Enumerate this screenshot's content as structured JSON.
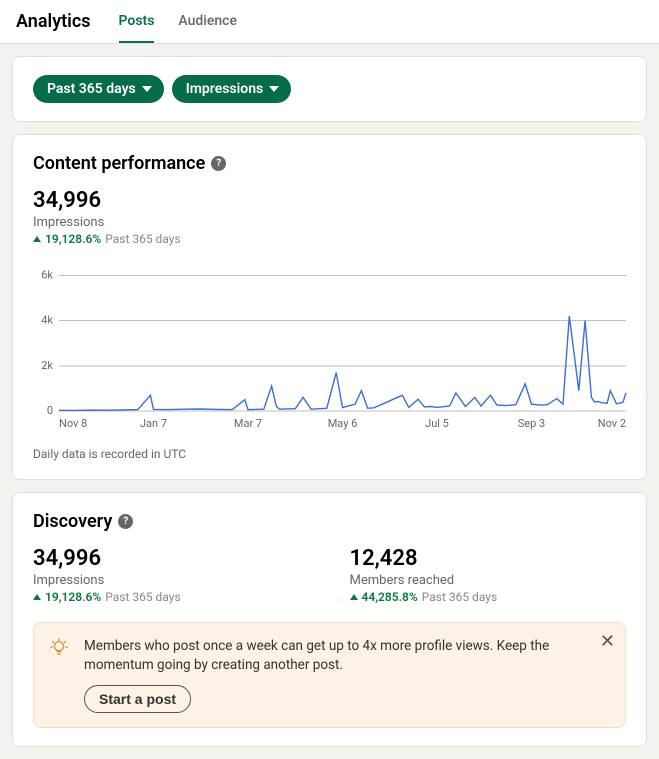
{
  "header": {
    "title": "Analytics",
    "tabs": {
      "posts": "Posts",
      "audience": "Audience"
    }
  },
  "filters": {
    "range": "Past 365 days",
    "metric": "Impressions"
  },
  "content_performance": {
    "heading": "Content performance",
    "metric_value": "34,996",
    "metric_label": "Impressions",
    "delta": "19,128.6%",
    "delta_period": "Past 365 days",
    "chart_note": "Daily data is recorded in UTC"
  },
  "discovery": {
    "heading": "Discovery",
    "impressions": {
      "value": "34,996",
      "label": "Impressions",
      "delta": "19,128.6%",
      "delta_period": "Past 365 days"
    },
    "members_reached": {
      "value": "12,428",
      "label": "Members reached",
      "delta": "44,285.8%",
      "delta_period": "Past 365 days"
    },
    "tip": {
      "text": "Members who post once a week can get up to 4x more profile views. Keep the momentum going by creating another post.",
      "cta": "Start a post"
    }
  },
  "chart_data": {
    "type": "line",
    "title": "",
    "xlabel": "",
    "ylabel": "",
    "ylim": [
      0,
      6500
    ],
    "y_ticks": [
      0,
      2000,
      4000,
      6000
    ],
    "y_tick_labels": [
      "0",
      "2k",
      "4k",
      "6k"
    ],
    "x_tick_labels": [
      "Nov 8",
      "Jan 7",
      "Mar 7",
      "May 6",
      "Jul 5",
      "Sep 3",
      "Nov 2"
    ],
    "x": [
      0,
      10,
      20,
      30,
      40,
      50,
      58,
      60,
      70,
      80,
      90,
      100,
      110,
      118,
      120,
      130,
      135,
      138,
      140,
      150,
      155,
      160,
      170,
      176,
      180,
      188,
      192,
      196,
      200,
      210,
      218,
      222,
      228,
      232,
      236,
      240,
      248,
      252,
      258,
      264,
      268,
      274,
      278,
      284,
      290,
      296,
      300,
      306,
      310,
      316,
      320,
      324,
      330,
      334,
      338,
      340,
      342,
      344,
      346,
      348,
      350,
      354,
      358,
      360
    ],
    "values": [
      30,
      25,
      40,
      35,
      50,
      60,
      700,
      70,
      60,
      80,
      90,
      70,
      60,
      500,
      60,
      80,
      1100,
      200,
      80,
      100,
      600,
      80,
      120,
      1700,
      150,
      300,
      900,
      120,
      140,
      450,
      700,
      160,
      520,
      180,
      200,
      160,
      220,
      800,
      200,
      600,
      220,
      700,
      260,
      240,
      280,
      1200,
      300,
      260,
      280,
      550,
      300,
      4200,
      900,
      4000,
      600,
      400,
      420,
      380,
      360,
      340,
      900,
      320,
      380,
      800
    ]
  }
}
